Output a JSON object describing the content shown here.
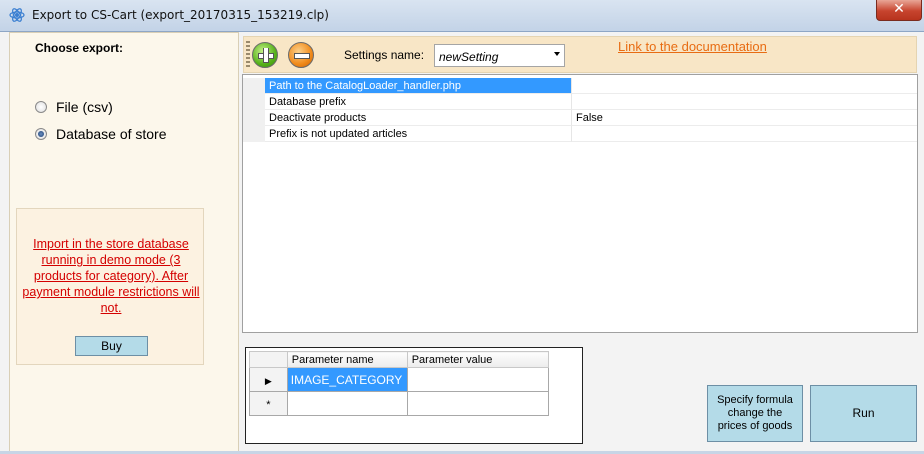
{
  "window": {
    "title": "Export to CS-Cart (export_20170315_153219.clp)",
    "close_glyph": "✕"
  },
  "left_panel": {
    "choose_label": "Choose export:",
    "options": [
      {
        "label": "File (csv)",
        "checked": false
      },
      {
        "label": "Database of store",
        "checked": true
      }
    ],
    "demo_notice": "Import in the store database running in demo mode (3 products for category). After payment module restrictions will not.",
    "buy_label": "Buy"
  },
  "toolbar": {
    "add_icon": "plus-circle-icon",
    "remove_icon": "minus-circle-icon",
    "settings_label": "Settings name:",
    "settings_value": "newSetting",
    "doc_link": "Link to the documentation"
  },
  "properties": [
    {
      "name": "Path to the CatalogLoader_handler.php",
      "value": "",
      "selected": true
    },
    {
      "name": "Database prefix",
      "value": ""
    },
    {
      "name": "Deactivate products",
      "value": "False"
    },
    {
      "name": "Prefix is not updated articles",
      "value": ""
    }
  ],
  "parameters": {
    "columns": [
      "Parameter name",
      "Parameter value"
    ],
    "rows": [
      {
        "marker": "▶",
        "name": "IMAGE_CATEGORY",
        "value": ""
      },
      {
        "marker": "*",
        "name": "",
        "value": ""
      }
    ]
  },
  "buttons": {
    "formula": "Specify formula change the prices of goods",
    "run": "Run"
  },
  "colors": {
    "link_red": "#d40000",
    "link_orange": "#e86c13",
    "button_bg": "#b4dbe8",
    "selection": "#3399ff"
  }
}
